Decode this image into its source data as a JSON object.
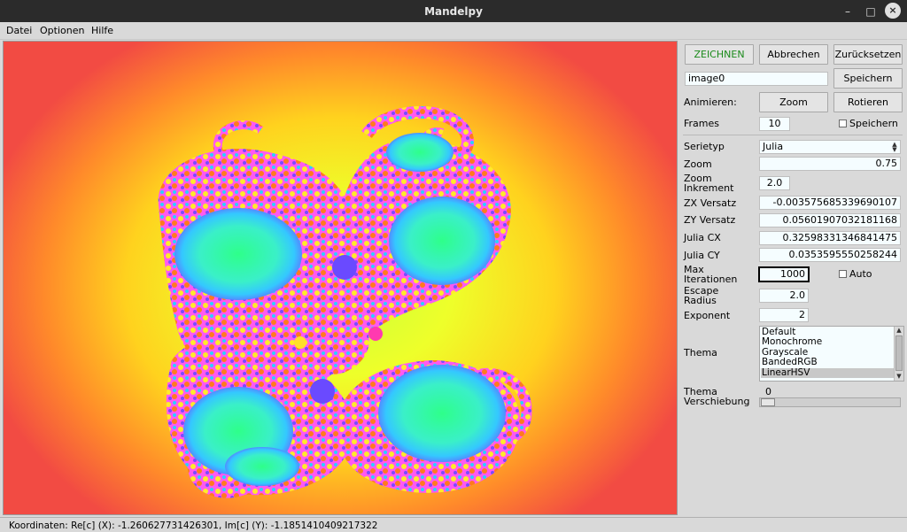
{
  "window": {
    "title": "Mandelpy",
    "minimize": "–",
    "maximize": "□",
    "close": "×"
  },
  "menu": {
    "items": [
      "Datei",
      "Optionen",
      "Hilfe"
    ]
  },
  "buttons": {
    "draw": "ZEICHNEN",
    "cancel": "Abbrechen",
    "reset": "Zurücksetzen",
    "save": "Speichern",
    "zoom": "Zoom",
    "rotate": "Rotieren"
  },
  "filename": {
    "value": "image0"
  },
  "animate": {
    "label": "Animieren:"
  },
  "frames": {
    "label": "Frames",
    "value": "10",
    "save_label": "Speichern",
    "save_checked": false
  },
  "params": {
    "series_type": {
      "label": "Serietyp",
      "value": "Julia"
    },
    "zoom": {
      "label": "Zoom",
      "value": "0.75"
    },
    "zoom_increment": {
      "label_line1": "Zoom",
      "label_line2": "Inkrement",
      "value": "2.0"
    },
    "zx_offset": {
      "label": "ZX Versatz",
      "value": "-0.003575685339690107"
    },
    "zy_offset": {
      "label": "ZY Versatz",
      "value": "0.05601907032181168"
    },
    "julia_cx": {
      "label": "Julia CX",
      "value": "0.32598331346841475"
    },
    "julia_cy": {
      "label": "Julia CY",
      "value": "0.0353595550258244"
    },
    "max_iter": {
      "label_line1": "Max",
      "label_line2": "Iterationen",
      "value": "1000",
      "auto_label": "Auto",
      "auto_checked": false
    },
    "escape_radius": {
      "label_line1": "Escape",
      "label_line2": "Radius",
      "value": "2.0"
    },
    "exponent": {
      "label": "Exponent",
      "value": "2"
    }
  },
  "theme": {
    "label": "Thema",
    "options": [
      "Default",
      "Monochrome",
      "Grayscale",
      "BandedRGB",
      "LinearHSV"
    ],
    "selected": "LinearHSV",
    "shift_label_line1": "Thema",
    "shift_label_line2": "Verschiebung",
    "shift_value": "0"
  },
  "status": {
    "text": "Koordinaten: Re[c] (X): -1.260627731426301,  Im[c] (Y): -1.1851410409217322"
  },
  "colors": {
    "fractal_outer": "#f24b43",
    "fractal_inner": "#eeff2a",
    "accent_green": "#1a8a1a",
    "entry_bg": "#f5fdff"
  },
  "icons": {
    "combo": "spin-arrows-icon",
    "checkbox": "checkbox-icon",
    "scroll_up": "scroll-up-icon",
    "scroll_down": "scroll-down-icon"
  }
}
